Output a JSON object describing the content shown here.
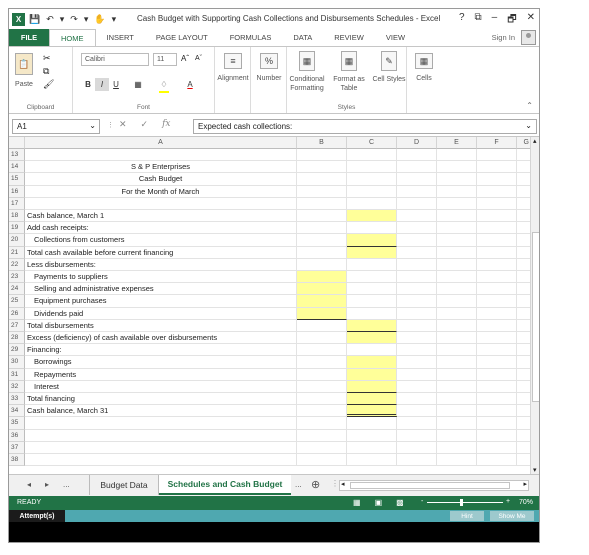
{
  "window": {
    "title": "Cash Budget with Supporting Cash Collections and Disbursements Schedules - Excel",
    "controls": [
      "?",
      "⧉",
      "–",
      "🗗",
      "✕"
    ]
  },
  "ribbon_tabs": {
    "file": "FILE",
    "items": [
      "HOME",
      "INSERT",
      "PAGE LAYOUT",
      "FORMULAS",
      "DATA",
      "REVIEW",
      "VIEW"
    ],
    "active": "HOME",
    "sign_in": "Sign In"
  },
  "ribbon": {
    "clipboard": {
      "paste": "Paste",
      "label": "Clipboard"
    },
    "font": {
      "name": "Calibri",
      "size": "11",
      "bold": "B",
      "italic": "I",
      "underline": "U",
      "label": "Font"
    },
    "alignment": "Alignment",
    "number": {
      "symbol": "%",
      "label": "Number"
    },
    "conditional_formatting": "Conditional Formatting",
    "format_as_table": "Format as Table",
    "cell_styles": "Cell Styles",
    "styles_label": "Styles",
    "cells": "Cells"
  },
  "formula_bar": {
    "name_box": "A1",
    "fx": "fx",
    "content": "Expected cash collections:"
  },
  "columns": [
    "A",
    "B",
    "C",
    "D",
    "E",
    "F",
    "G"
  ],
  "rows": [
    {
      "num": "13",
      "a": ""
    },
    {
      "num": "14",
      "a": "S & P Enterprises",
      "align": "center"
    },
    {
      "num": "15",
      "a": "Cash Budget",
      "align": "center"
    },
    {
      "num": "16",
      "a": "For the Month of March",
      "align": "center"
    },
    {
      "num": "17",
      "a": ""
    },
    {
      "num": "18",
      "a": "Cash balance, March 1",
      "c": "yellow"
    },
    {
      "num": "19",
      "a": "Add cash receipts:"
    },
    {
      "num": "20",
      "a": "Collections from customers",
      "indent": true,
      "c": "yellow-underline"
    },
    {
      "num": "21",
      "a": "Total cash available before current financing",
      "c": "yellow"
    },
    {
      "num": "22",
      "a": "Less disbursements:"
    },
    {
      "num": "23",
      "a": "Payments to suppliers",
      "indent": true,
      "b": "yellow"
    },
    {
      "num": "24",
      "a": "Selling and administrative expenses",
      "indent": true,
      "b": "yellow"
    },
    {
      "num": "25",
      "a": "Equipment purchases",
      "indent": true,
      "b": "yellow"
    },
    {
      "num": "26",
      "a": "Dividends paid",
      "indent": true,
      "b": "yellow-underline"
    },
    {
      "num": "27",
      "a": "Total disbursements",
      "c": "yellow-underline"
    },
    {
      "num": "28",
      "a": "Excess (deficiency) of cash available over disbursements",
      "c": "yellow"
    },
    {
      "num": "29",
      "a": "Financing:"
    },
    {
      "num": "30",
      "a": "Borrowings",
      "indent": true,
      "c": "yellow"
    },
    {
      "num": "31",
      "a": "Repayments",
      "indent": true,
      "c": "yellow"
    },
    {
      "num": "32",
      "a": "Interest",
      "indent": true,
      "c": "yellow-underline"
    },
    {
      "num": "33",
      "a": "Total financing",
      "c": "yellow-underline"
    },
    {
      "num": "34",
      "a": "Cash balance, March 31",
      "c": "yellow-double"
    },
    {
      "num": "35",
      "a": ""
    },
    {
      "num": "36",
      "a": ""
    },
    {
      "num": "37",
      "a": ""
    },
    {
      "num": "38",
      "a": ""
    }
  ],
  "sheet_tabs": {
    "nav": [
      "◂",
      "▸",
      "..."
    ],
    "tabs": [
      "Budget Data",
      "Schedules and Cash Budget"
    ],
    "active": "Schedules and Cash Budget",
    "more": "...",
    "add": "⊕"
  },
  "status": {
    "text": "READY",
    "zoom": "70%",
    "minus": "-",
    "plus": "+"
  },
  "assessment": {
    "attempts": "Attempt(s)",
    "hint": "Hint",
    "show_me": "Show Me"
  }
}
